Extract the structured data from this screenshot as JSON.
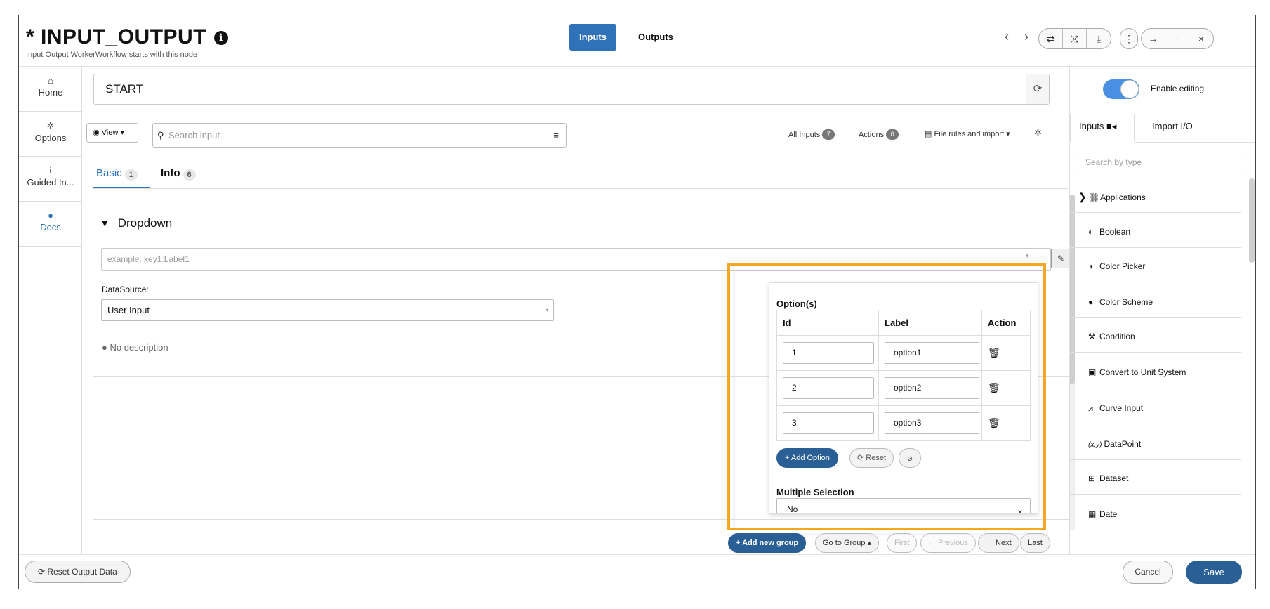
{
  "header": {
    "title": "* INPUT_OUTPUT",
    "subtitle": "Input Output WorkerWorkflow starts with this node",
    "tabs": [
      {
        "label": "Inputs",
        "active": true
      },
      {
        "label": "Outputs",
        "active": false
      }
    ],
    "nav_prev": "‹",
    "nav_next": "›",
    "toolbar_icons": [
      "swap-icon",
      "shuffle-icon",
      "download-icon",
      "more-icon",
      "arrow-right-icon",
      "minimize-icon",
      "close-icon"
    ]
  },
  "sidebar": {
    "items": [
      {
        "label": "Home",
        "icon": "home-icon"
      },
      {
        "label": "Options",
        "icon": "gear-icon"
      },
      {
        "label": "Guided In...",
        "icon": "info-icon"
      },
      {
        "label": "Docs",
        "icon": "info-circle-icon"
      }
    ]
  },
  "main": {
    "node_name": "START",
    "view_label": "View ▾",
    "search_placeholder": "Search input",
    "all_inputs_label": "All Inputs",
    "all_inputs_count": "7",
    "actions_label": "Actions",
    "actions_count": "0",
    "file_rules_label": "File rules and import ▾",
    "subtabs": [
      {
        "label": "Basic",
        "count": "1"
      },
      {
        "label": "Info",
        "count": "6"
      }
    ],
    "section_title": "Dropdown",
    "dropdown_placeholder": "example: key1:Label1",
    "datasource_label": "DataSource:",
    "datasource_value": "User Input",
    "no_description": "No description"
  },
  "options_popup": {
    "title": "Option(s)",
    "columns": [
      "Id",
      "Label",
      "Action"
    ],
    "rows": [
      {
        "id": "1",
        "label": "option1"
      },
      {
        "id": "2",
        "label": "option2"
      },
      {
        "id": "3",
        "label": "option3"
      }
    ],
    "add_label": "+ Add Option",
    "reset_label": "Reset",
    "multiple_label": "Multiple Selection",
    "multiple_value": "No"
  },
  "pagination": {
    "add_group": "+ Add new group",
    "go_to_group": "Go to Group ▴",
    "first": "First",
    "previous": "← Previous",
    "next": "→ Next",
    "last": "Last"
  },
  "right_panel": {
    "toggle_label": "Enable editing",
    "tabs": [
      "Inputs",
      "Import I/O"
    ],
    "search_placeholder": "Search by type",
    "types": [
      {
        "label": "Applications",
        "icon": "link-icon"
      },
      {
        "label": "Boolean",
        "icon": "toggle-icon"
      },
      {
        "label": "Color Picker",
        "icon": "half-circle-icon"
      },
      {
        "label": "Color Scheme",
        "icon": "palette-icon"
      },
      {
        "label": "Condition",
        "icon": "gavel-icon"
      },
      {
        "label": "Convert to Unit System",
        "icon": "scale-icon"
      },
      {
        "label": "Curve Input",
        "icon": "line-chart-icon"
      },
      {
        "label": "DataPoint",
        "icon_text": "(x,y)"
      },
      {
        "label": "Dataset",
        "icon": "table-icon"
      },
      {
        "label": "Date",
        "icon": "calendar-icon"
      }
    ]
  },
  "footer": {
    "reset_output": "Reset Output Data",
    "cancel": "Cancel",
    "save": "Save"
  },
  "colors": {
    "accent": "#2f72b8",
    "primary_button": "#2a5f96",
    "highlight": "#f5a623",
    "toggle": "#4a90e2"
  }
}
